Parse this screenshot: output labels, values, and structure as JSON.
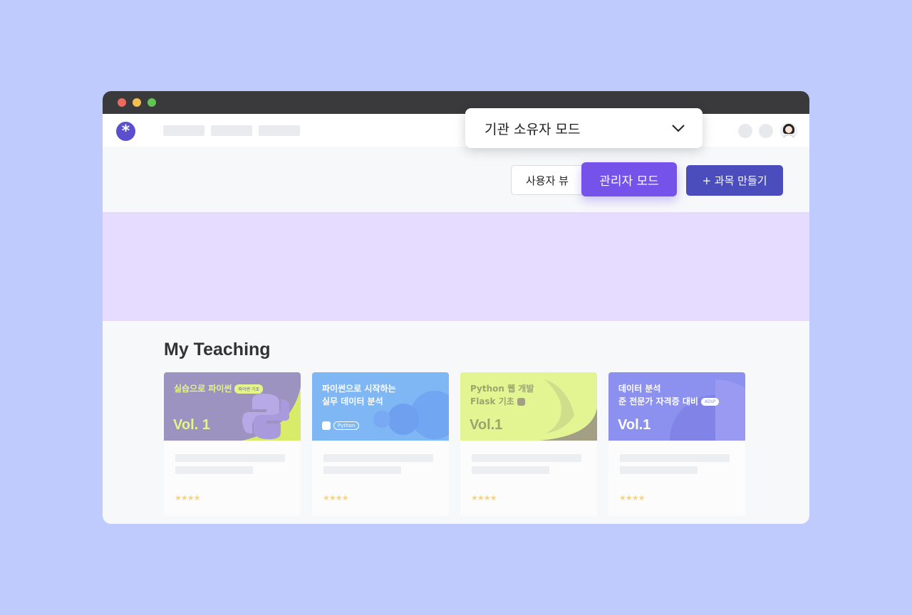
{
  "dropdown": {
    "label": "기관 소유자 모드",
    "icon": "chevron-down-icon"
  },
  "toolbar": {
    "user_view_label": "사용자 뷰",
    "admin_mode_label": "관리자 모드",
    "create_course_label": "+ 과목 만들기"
  },
  "section": {
    "title": "My Teaching"
  },
  "courses": [
    {
      "line1": "실습으로 파이썬",
      "tag": "파이썬 기초",
      "line2": "",
      "vol": "Vol. 1",
      "stars": "★★★★",
      "bg": "#9c93c0"
    },
    {
      "line1": "파이썬으로 시작하는",
      "tag": "",
      "line2": "실무 데이터 분석",
      "badge": "Python",
      "vol": "",
      "stars": "★★★★",
      "bg": "#7fb7f4"
    },
    {
      "line1": "Python 웹 개발",
      "tag": "",
      "line2": "Flask 기초",
      "vol": "Vol.1",
      "stars": "★★★★",
      "bg": "#e2f592"
    },
    {
      "line1": "데이터 분석",
      "tag": "",
      "line2": "준 전문가 자격증 대비",
      "badge": "ADsP",
      "vol": "Vol.1",
      "stars": "★★★★",
      "bg": "#8c90ef"
    }
  ],
  "colors": {
    "accent": "#7552ea",
    "create": "#4a4dbb",
    "banner": "#e6dcff",
    "background": "#bfcbfd"
  }
}
